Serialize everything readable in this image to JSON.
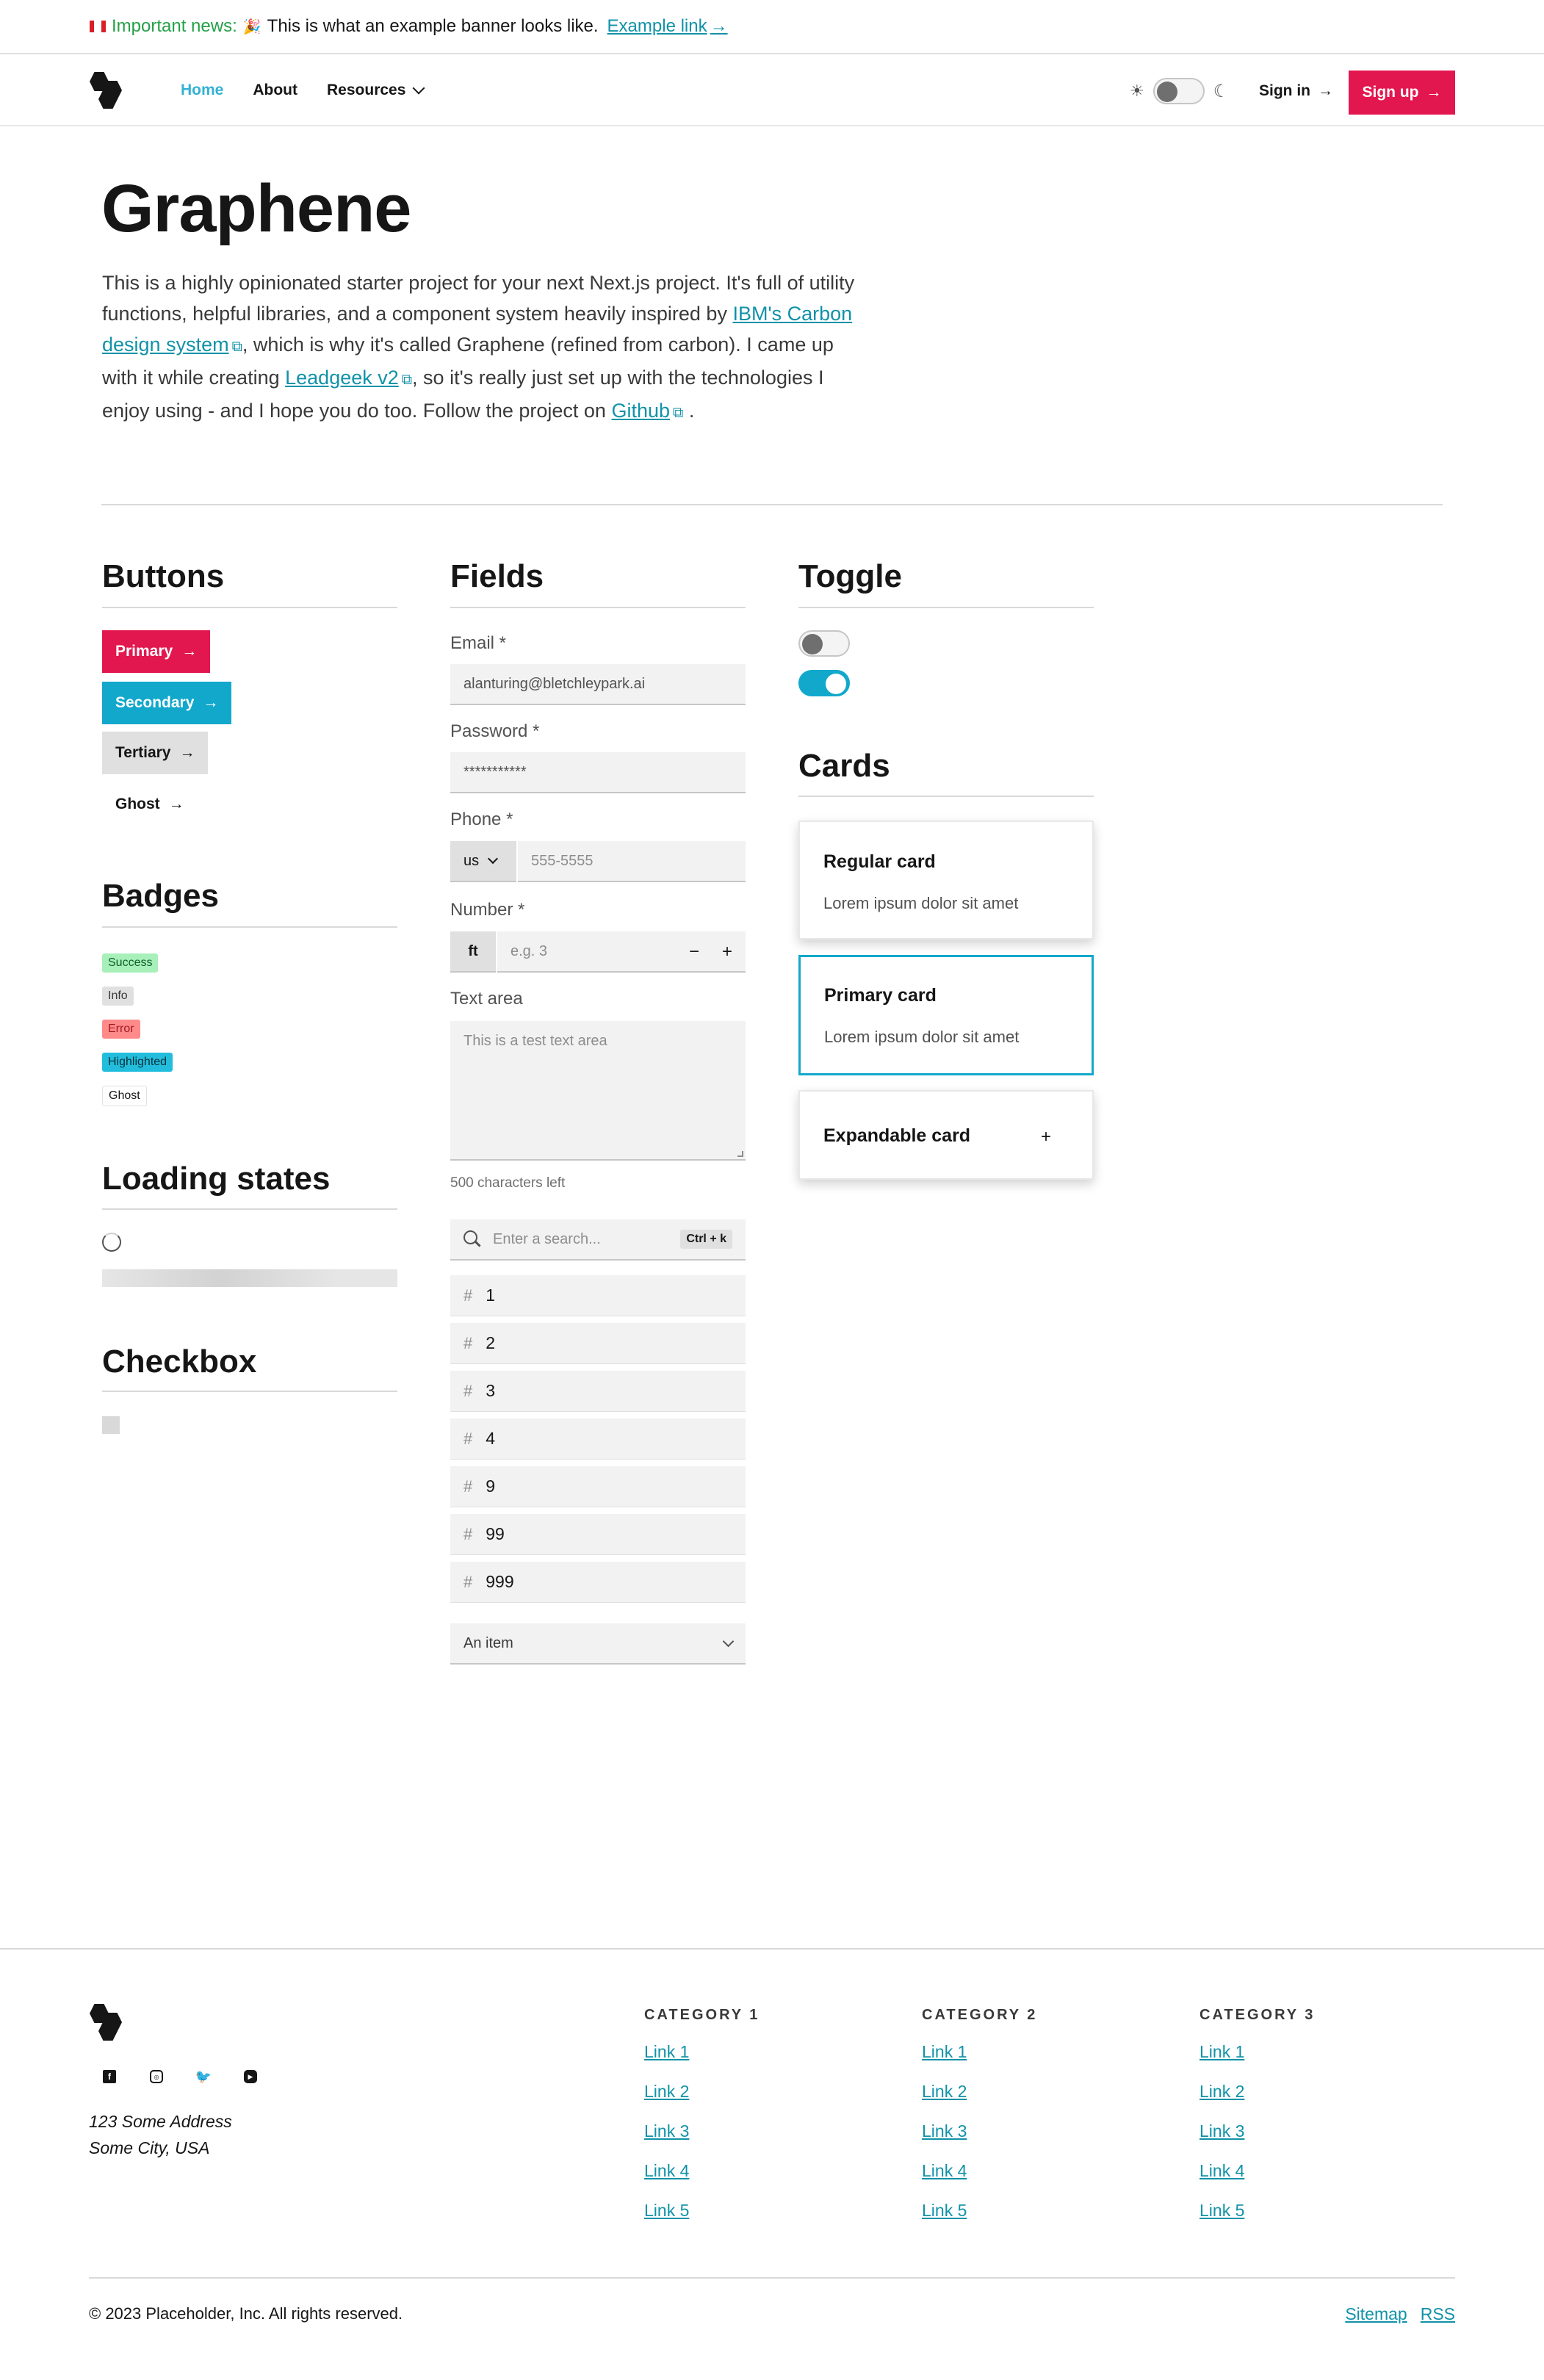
{
  "banner": {
    "label": "Important news",
    "separator": ":",
    "party_icon": "🎉",
    "text": "This is what an example banner looks like.",
    "link": "Example link"
  },
  "header": {
    "nav": {
      "home": "Home",
      "about": "About",
      "resources": "Resources"
    },
    "theme": {
      "sun": "☀",
      "moon": "☾"
    },
    "sign_in": "Sign in",
    "sign_up": "Sign up",
    "arrow": "→"
  },
  "hero": {
    "title": "Graphene",
    "text_1": "This is a highly opinionated starter project for your next Next.js project. It's full of utility functions, helpful libraries, and a component system heavily inspired by",
    "link_carbon": "IBM's Carbon design system",
    "text_2": ", which is why it's called Graphene (refined from carbon). I came up with it while creating",
    "link_leadgeek": "Leadgeek v2",
    "text_3": ", so it's really just set up with the technologies I enjoy using - and I hope you do too. Follow the project on",
    "link_github": "Github",
    "text_4": ".",
    "ext_icon": "⧉"
  },
  "buttons": {
    "title": "Buttons",
    "primary": "Primary",
    "secondary": "Secondary",
    "tertiary": "Tertiary",
    "ghost": "Ghost"
  },
  "badges": {
    "title": "Badges",
    "success": "Success",
    "info": "Info",
    "error": "Error",
    "highlighted": "Highlighted",
    "ghost": "Ghost"
  },
  "loading": {
    "title": "Loading states"
  },
  "checkbox": {
    "title": "Checkbox",
    "checked": false
  },
  "fields": {
    "title": "Fields",
    "email_label": "Email *",
    "email_value": "alanturing@bletchleypark.ai",
    "password_label": "Password *",
    "password_value": "***********",
    "phone_label": "Phone *",
    "phone_code": "us",
    "phone_placeholder": "555-5555",
    "number_label": "Number *",
    "number_unit": "ft",
    "number_placeholder": "e.g. 3",
    "minus": "−",
    "plus": "+",
    "textarea_label": "Text area",
    "textarea_placeholder": "This is a test text area",
    "chars_left": "500 characters left",
    "search_placeholder": "Enter a search...",
    "search_shortcut": "Ctrl + k",
    "hash": "#",
    "numbers": [
      "1",
      "2",
      "3",
      "4",
      "9",
      "99",
      "999"
    ],
    "select_value": "An item"
  },
  "toggle": {
    "title": "Toggle",
    "toggle_1_on": false,
    "toggle_2_on": true
  },
  "cards": {
    "title": "Cards",
    "regular_title": "Regular card",
    "regular_body": "Lorem ipsum dolor sit amet",
    "primary_title": "Primary card",
    "primary_body": "Lorem ipsum dolor sit amet",
    "expandable_title": "Expandable card",
    "expand_icon": "+"
  },
  "footer": {
    "social": [
      "facebook-icon",
      "instagram-icon",
      "twitter-icon",
      "youtube-icon"
    ],
    "address_1": "123 Some Address",
    "address_2": "Some City, USA",
    "categories": [
      {
        "title": "CATEGORY 1",
        "links": [
          "Link 1",
          "Link 2",
          "Link 3",
          "Link 4",
          "Link 5"
        ]
      },
      {
        "title": "CATEGORY 2",
        "links": [
          "Link 1",
          "Link 2",
          "Link 3",
          "Link 4",
          "Link 5"
        ]
      },
      {
        "title": "CATEGORY 3",
        "links": [
          "Link 1",
          "Link 2",
          "Link 3",
          "Link 4",
          "Link 5"
        ]
      }
    ],
    "copyright": "© 2023 Placeholder, Inc. All rights reserved.",
    "sitemap": "Sitemap",
    "rss": "RSS"
  },
  "colors": {
    "brand_primary": "#e3174f",
    "brand_secondary": "#12a8cc",
    "link": "#1192a8",
    "nav_active": "#33b1d4"
  }
}
